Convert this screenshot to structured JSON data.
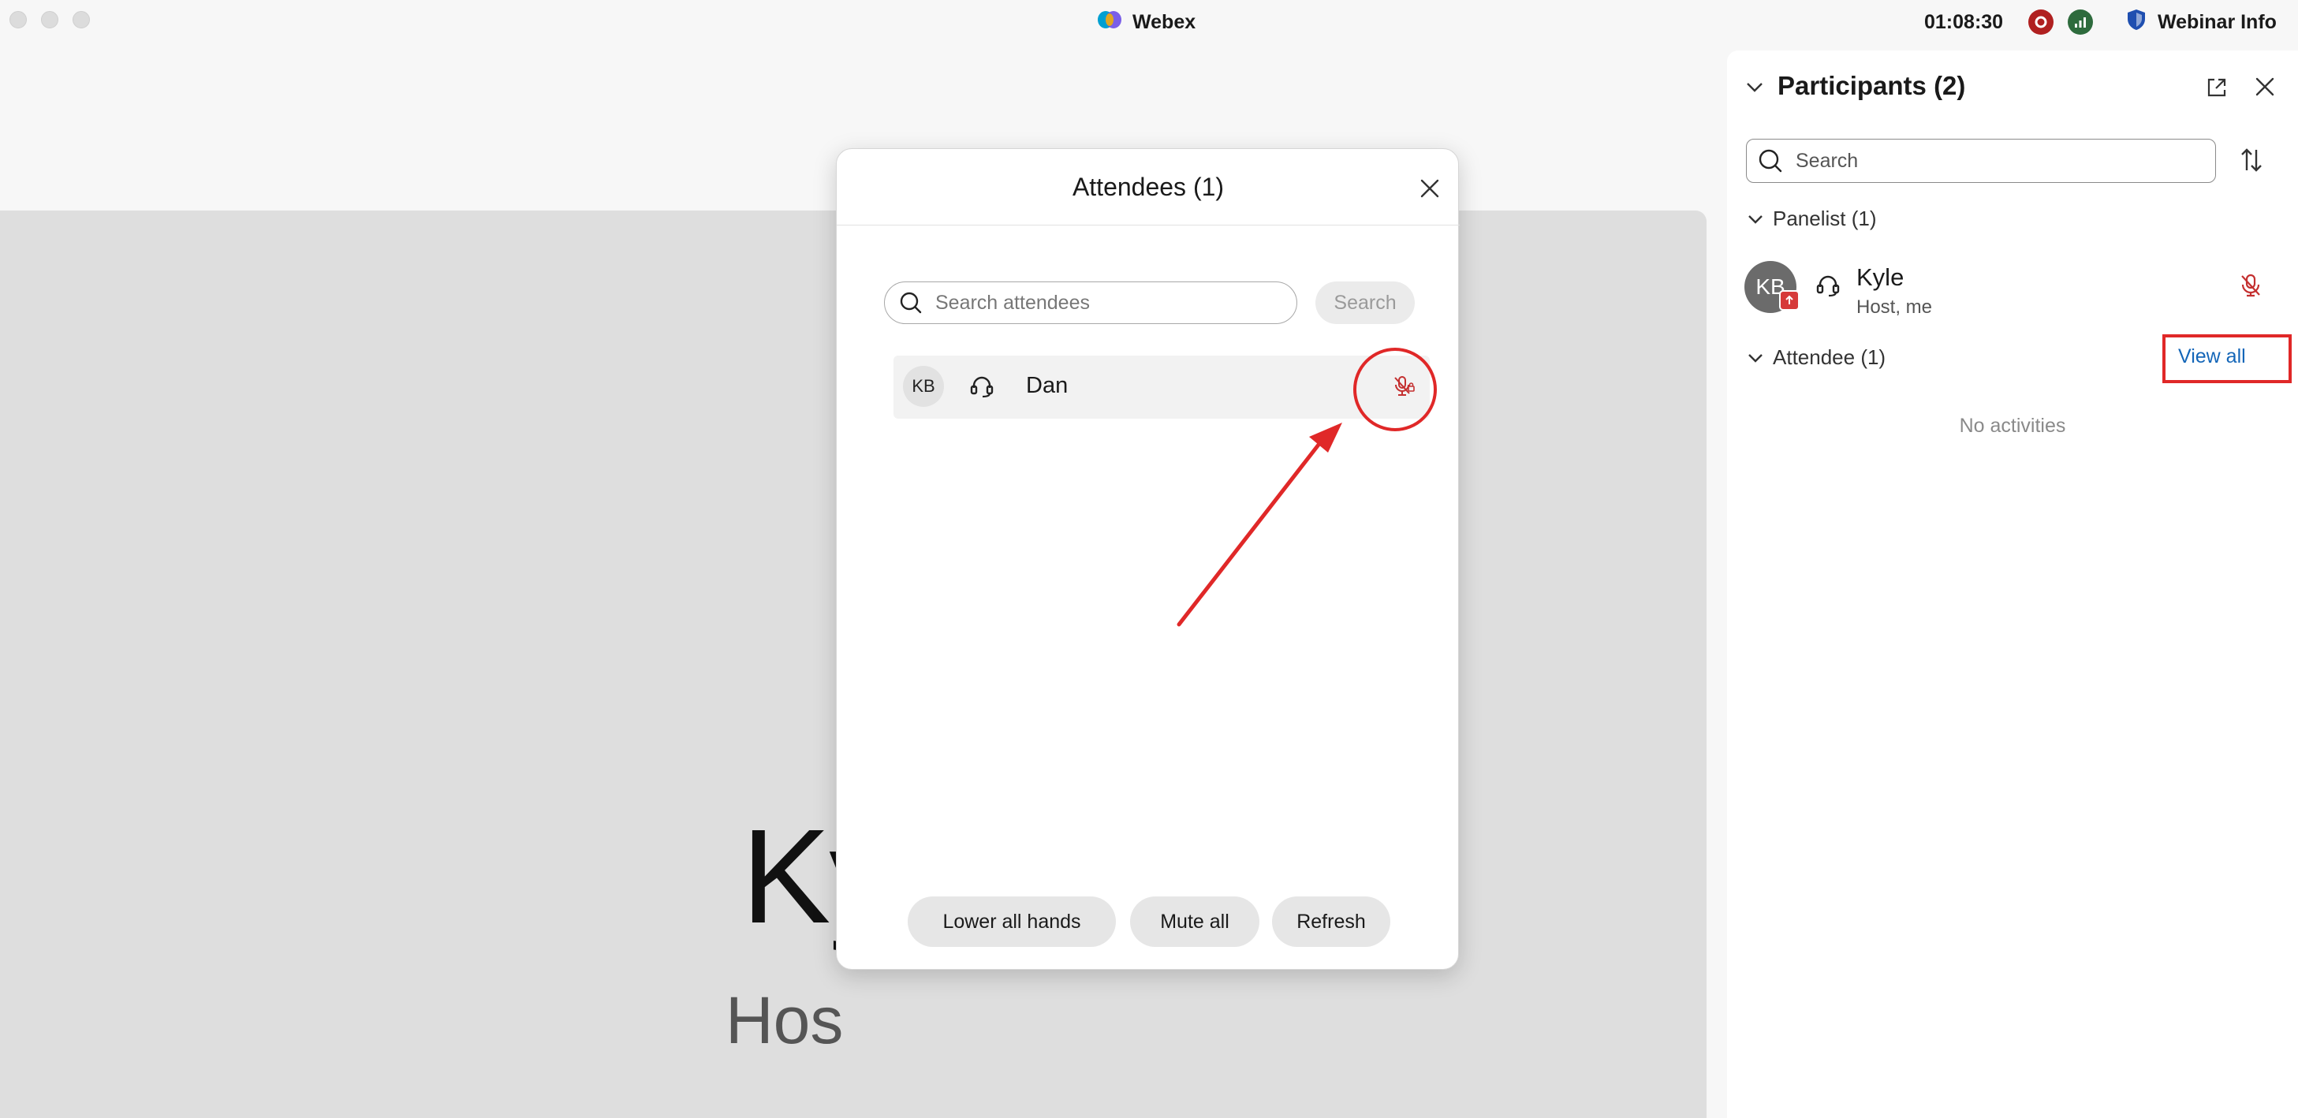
{
  "titlebar": {
    "app_name": "Webex",
    "clock": "01:08:30",
    "webinar_info_label": "Webinar Info",
    "icons": [
      "webex-logo-icon",
      "recording-icon",
      "network-stats-icon",
      "shield-icon"
    ]
  },
  "stage": {
    "name_partial": "Ky",
    "role_partial": "Hos"
  },
  "dialog": {
    "title": "Attendees (1)",
    "search_placeholder": "Search attendees",
    "search_button": "Search",
    "attendees": [
      {
        "initials": "KB",
        "name": "Dan"
      }
    ],
    "buttons": {
      "lower_hands": "Lower all hands",
      "mute_all": "Mute all",
      "refresh": "Refresh"
    }
  },
  "panel": {
    "title": "Participants (2)",
    "search_placeholder": "Search",
    "panelist_section": "Panelist (1)",
    "panelist": {
      "initials": "KB",
      "name": "Kyle",
      "role": "Host, me"
    },
    "attendee_section": "Attendee (1)",
    "view_all": "View all",
    "empty_text": "No activities"
  },
  "colors": {
    "accent_red": "#e02828",
    "link_blue": "#1466b8",
    "stage_bg": "#dedede"
  }
}
